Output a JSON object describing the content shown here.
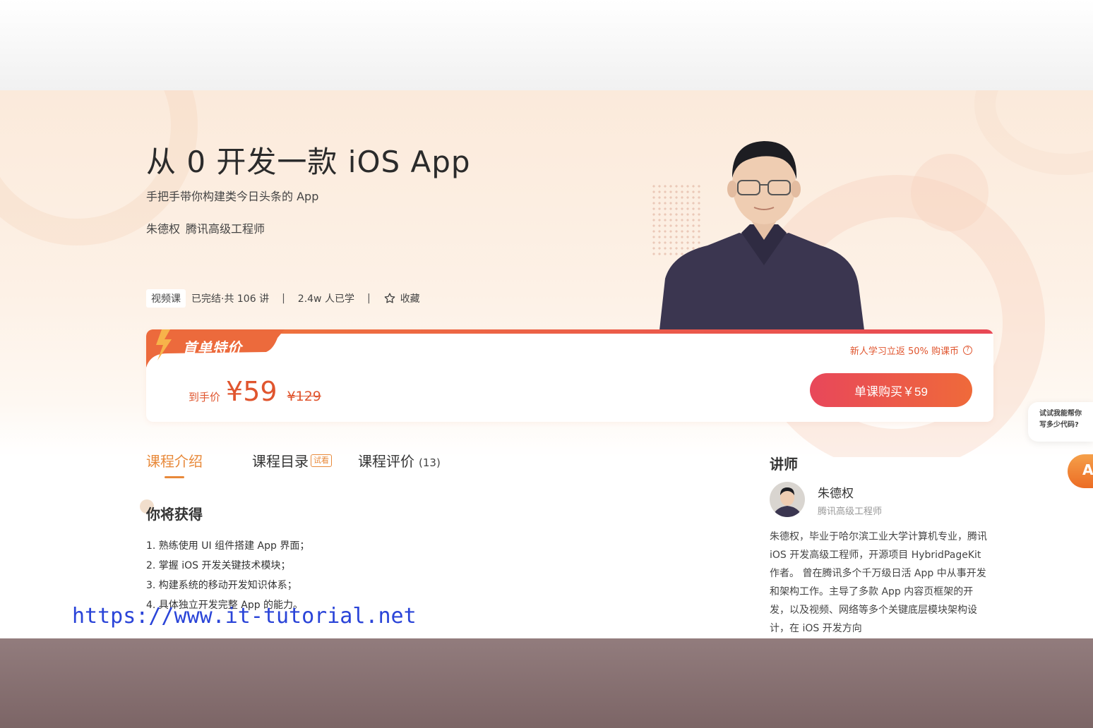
{
  "course": {
    "title": "从 0 开发一款 iOS App",
    "subtitle": "手把手带你构建类今日头条的 App",
    "teacher_name": "朱德权",
    "teacher_role": "腾讯高级工程师"
  },
  "meta": {
    "tag": "视频课",
    "status": "已完结·共 106 讲",
    "separator": "|",
    "learners": "2.4w 人已学",
    "favorite_label": "收藏"
  },
  "pricing": {
    "badge": "首单特价",
    "promo": "新人学习立返 50% 购课币",
    "price_label": "到手价",
    "price_now": "¥59",
    "price_old": "¥129",
    "buy_label": "单课购买￥59"
  },
  "tabs": [
    {
      "label": "课程介绍",
      "active": true
    },
    {
      "label": "课程目录",
      "badge": "试看"
    },
    {
      "label": "课程评价",
      "count": "(13)"
    }
  ],
  "intro": {
    "section_title": "你将获得",
    "items": [
      "1. 熟练使用 UI 组件搭建 App 界面；",
      "2. 掌握 iOS 开发关键技术模块；",
      "3. 构建系统的移动开发知识体系；",
      "4. 具体独立开发完整 App 的能力。"
    ]
  },
  "instructor": {
    "section_title": "讲师",
    "name": "朱德权",
    "role": "腾讯高级工程师",
    "bio": "朱德权，毕业于哈尔滨工业大学计算机专业，腾讯 iOS 开发高级工程师，开源项目 HybridPageKit 作者。 曾在腾讯多个千万级日活 App 中从事开发和架构工作。主导了多款 App 内容页框架的开发，以及视频、网络等多个关键底层模块架构设计，在 iOS 开发方向"
  },
  "helper": {
    "line1": "试试我能帮你",
    "line2": "写多少代码?",
    "button_letter": "A"
  },
  "watermark": "https://www.it-tutorial.net",
  "colors": {
    "accent_orange": "#e8893a",
    "price_red": "#e0552e",
    "button_start": "#e8475a",
    "button_end": "#ef6a3a",
    "watermark_blue": "#2a44d8"
  },
  "icons": {
    "favorite": "star-outline-icon",
    "promo_help": "question-circle-icon",
    "badge_bolt": "lightning-bolt-icon"
  }
}
